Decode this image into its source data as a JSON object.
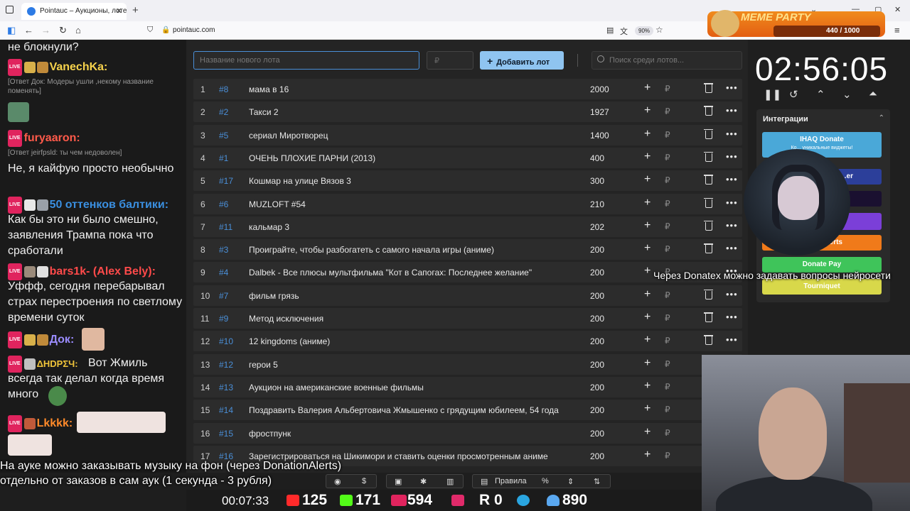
{
  "browser": {
    "tab_title": "Pointauc – Аукционы, лотереи",
    "tab_close": "✕",
    "new_tab": "+",
    "url": "pointauc.com",
    "zoom": "90%"
  },
  "meme_party": {
    "title": "MEME PARTY",
    "count": "440 / 1000"
  },
  "chat": {
    "lines": [
      {
        "text": "не блокнули?"
      },
      {
        "nick": "VanechKa:",
        "nick_color": "#f7d34c"
      },
      {
        "reply": "[Ответ Док: Модеры ушли ,некому название поменять]"
      },
      {
        "nick": "furyaaron:",
        "nick_color": "#ff5a4a"
      },
      {
        "reply": "[Ответ jeirfpsld: ты чем недоволен]"
      },
      {
        "text": "Не, я кайфую просто необычно"
      },
      {
        "nick": "50 оттенков балтики:",
        "nick_color": "#3a8fe0"
      },
      {
        "text": "Как бы это ни было смешно, заявления Трампа пока что сработали"
      },
      {
        "nick": "bars1k- (Alex Bely):",
        "nick_color": "#ff4a4a"
      },
      {
        "text": "Уффф, сегодня перебарывал страх перестроения по светлому времени суток"
      },
      {
        "nick": "Док:",
        "nick_color": "#9b8cff"
      },
      {
        "nick": "ΔHDPΣЧ:",
        "nick_color": "#f0c43a",
        "text": "Вот Жмиль всегда так делал когда время много"
      },
      {
        "nick": "Lkkkk:",
        "nick_color": "#ff8a2a"
      }
    ]
  },
  "controls": {
    "lot_placeholder": "Название нового лота",
    "amount_placeholder": "₽",
    "add_button": "Добавить лот",
    "search_placeholder": "Поиск среди лотов..."
  },
  "lots": [
    {
      "n": "1",
      "id": "#8",
      "name": "мама в 16",
      "amount": "2000",
      "trash": true
    },
    {
      "n": "2",
      "id": "#2",
      "name": "Такси 2",
      "amount": "1927",
      "trash": true
    },
    {
      "n": "3",
      "id": "#5",
      "name": "сериал Миротворец",
      "amount": "1400",
      "trash": true
    },
    {
      "n": "4",
      "id": "#1",
      "name": "ОЧЕНЬ ПЛОХИЕ ПАРНИ (2013)",
      "amount": "400",
      "trash": true
    },
    {
      "n": "5",
      "id": "#17",
      "name": "Кошмар на улице Вязов 3",
      "amount": "300",
      "trash": true
    },
    {
      "n": "6",
      "id": "#6",
      "name": "MUZLOFT #54",
      "amount": "210",
      "trash": true
    },
    {
      "n": "7",
      "id": "#11",
      "name": "кальмар 3",
      "amount": "202",
      "trash": true
    },
    {
      "n": "8",
      "id": "#3",
      "name": "Проиграйте, чтобы разбогатеть с самого начала игры (аниме)",
      "amount": "200",
      "trash": true
    },
    {
      "n": "9",
      "id": "#4",
      "name": "Dalbek - Все плюсы мультфильма \"Кот в Сапогах: Последнее желание\"",
      "amount": "200",
      "trash": false
    },
    {
      "n": "10",
      "id": "#7",
      "name": "фильм грязь",
      "amount": "200",
      "trash": true
    },
    {
      "n": "11",
      "id": "#9",
      "name": "Метод исключения",
      "amount": "200",
      "trash": true
    },
    {
      "n": "12",
      "id": "#10",
      "name": "12 kingdoms (аниме)",
      "amount": "200",
      "trash": true
    },
    {
      "n": "13",
      "id": "#12",
      "name": "герои 5",
      "amount": "200",
      "trash": false
    },
    {
      "n": "14",
      "id": "#13",
      "name": "Аукцион на американские военные фильмы",
      "amount": "200",
      "trash": false
    },
    {
      "n": "15",
      "id": "#14",
      "name": "Поздравить Валерия Альбертовича Жмышенко с грядущим юбилеем, 54 года",
      "amount": "200",
      "trash": false
    },
    {
      "n": "16",
      "id": "#15",
      "name": "фростпунк",
      "amount": "200",
      "trash": false
    },
    {
      "n": "17",
      "id": "#16",
      "name": "Зарегистрироваться на Шикимори и ставить оценки просмотренным аниме",
      "amount": "200",
      "trash": false
    }
  ],
  "timer": {
    "value": "02:56:05"
  },
  "integrations": {
    "title": "Интеграции",
    "items": [
      {
        "label": "IHAQ Donate",
        "sub": "Ко... уникальные виджеты!",
        "color": "#4aa8d8"
      },
      {
        "label": "...er",
        "color": "#2c3f9a"
      },
      {
        "label": "",
        "color": "#1a1030"
      },
      {
        "label": "",
        "color": "#7b3fd8"
      },
      {
        "label": "...Alerts",
        "color": "#f07a1a"
      },
      {
        "label": "Donate Pay",
        "color": "#3fc45a"
      },
      {
        "label": "Tourniquet",
        "color": "#d8d84a"
      }
    ]
  },
  "captions": {
    "donatex": "Через Donatex можно задавать вопросы нейросети",
    "bottom_line1": "На ауке можно заказывать музыку на фон (через DonationAlerts)",
    "bottom_line2": "отдельно от заказов в сам аук (1 секунда - 3 рубля)"
  },
  "toolbar": {
    "rules": "Правила",
    "percent": "%"
  },
  "stats": {
    "uptime": "00:07:33",
    "youtube": "125",
    "kick": "171",
    "live": "594",
    "rutube": "0",
    "telegram": "",
    "viewers": "890"
  }
}
